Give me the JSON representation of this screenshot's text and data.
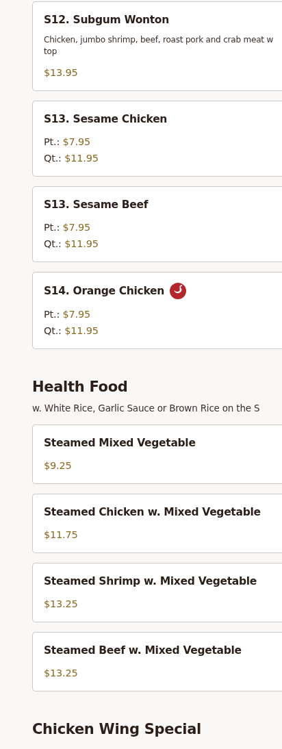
{
  "sections": [
    {
      "items": [
        {
          "name": "S12. Subgum Wonton",
          "spicy": false,
          "description": "Chicken, jumbo shrimp, beef, roast pork and crab meat w\ntop",
          "prices": [
            {
              "value": "$13.95"
            }
          ]
        },
        {
          "name": "S13. Sesame Chicken",
          "spicy": false,
          "prices": [
            {
              "label": "Pt.:",
              "value": "$7.95"
            },
            {
              "label": "Qt.:",
              "value": "$11.95"
            }
          ]
        },
        {
          "name": "S13. Sesame Beef",
          "spicy": false,
          "prices": [
            {
              "label": "Pt.:",
              "value": "$7.95"
            },
            {
              "label": "Qt.:",
              "value": "$11.95"
            }
          ]
        },
        {
          "name": "S14. Orange Chicken",
          "spicy": true,
          "prices": [
            {
              "label": "Pt.:",
              "value": "$7.95"
            },
            {
              "label": "Qt.:",
              "value": "$11.95"
            }
          ]
        }
      ]
    },
    {
      "title": "Health Food",
      "subtitle": "w. White Rice, Garlic Sauce or Brown Rice on the S",
      "items": [
        {
          "name": "Steamed Mixed Vegetable",
          "spicy": false,
          "prices": [
            {
              "value": "$9.25"
            }
          ]
        },
        {
          "name": "Steamed Chicken w. Mixed Vegetable",
          "spicy": false,
          "prices": [
            {
              "value": "$11.75"
            }
          ]
        },
        {
          "name": "Steamed Shrimp w. Mixed Vegetable",
          "spicy": false,
          "prices": [
            {
              "value": "$13.25"
            }
          ]
        },
        {
          "name": "Steamed Beef w. Mixed Vegetable",
          "spicy": false,
          "prices": [
            {
              "value": "$13.25"
            }
          ]
        }
      ]
    },
    {
      "title": "Chicken Wing Special"
    }
  ]
}
